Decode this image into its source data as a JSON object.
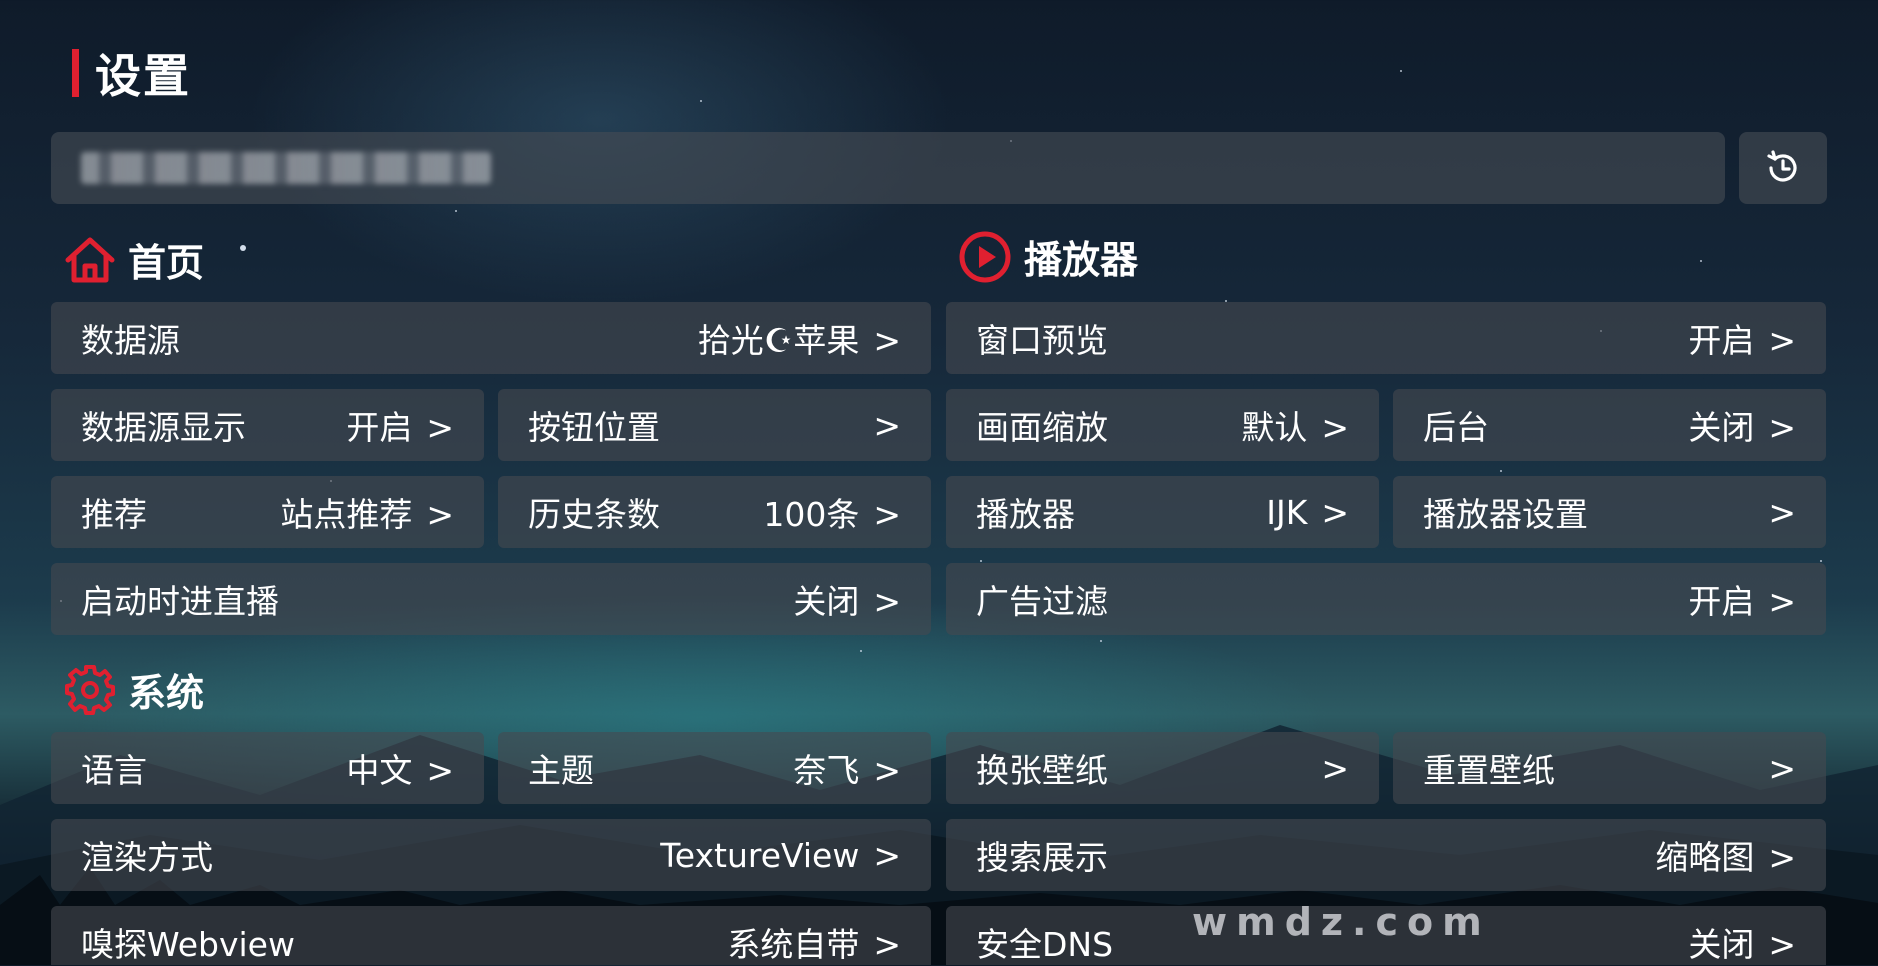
{
  "header": {
    "title": "设置"
  },
  "history_button": {
    "icon": "history-icon"
  },
  "sections": {
    "home": {
      "label": "首页",
      "icon": "home-icon"
    },
    "player": {
      "label": "播放器",
      "icon": "play-circle-icon"
    },
    "system": {
      "label": "系统",
      "icon": "gear-icon"
    }
  },
  "accent_color": "#e02030",
  "arrow": ">",
  "home": {
    "datasource": {
      "label": "数据源",
      "value": "拾光☪苹果"
    },
    "datasource_display": {
      "label": "数据源显示",
      "value": "开启"
    },
    "button_position": {
      "label": "按钮位置",
      "value": ""
    },
    "recommend": {
      "label": "推荐",
      "value": "站点推荐"
    },
    "history_count": {
      "label": "历史条数",
      "value": "100条"
    },
    "live_on_start": {
      "label": "启动时进直播",
      "value": "关闭"
    }
  },
  "player": {
    "window_preview": {
      "label": "窗口预览",
      "value": "开启"
    },
    "scale": {
      "label": "画面缩放",
      "value": "默认"
    },
    "background": {
      "label": "后台",
      "value": "关闭"
    },
    "player": {
      "label": "播放器",
      "value": "IJK"
    },
    "player_settings": {
      "label": "播放器设置",
      "value": ""
    },
    "ad_filter": {
      "label": "广告过滤",
      "value": "开启"
    }
  },
  "system": {
    "language": {
      "label": "语言",
      "value": "中文"
    },
    "theme": {
      "label": "主题",
      "value": "奈飞"
    },
    "change_wallpaper": {
      "label": "换张壁纸",
      "value": ""
    },
    "reset_wallpaper": {
      "label": "重置壁纸",
      "value": ""
    },
    "render": {
      "label": "渲染方式",
      "value": "TextureView"
    },
    "search_display": {
      "label": "搜索展示",
      "value": "缩略图"
    },
    "sniff_webview": {
      "label": "嗅探Webview",
      "value": "系统自带"
    },
    "secure_dns": {
      "label": "安全DNS",
      "value": "关闭"
    }
  },
  "watermark": "wmdz.com"
}
